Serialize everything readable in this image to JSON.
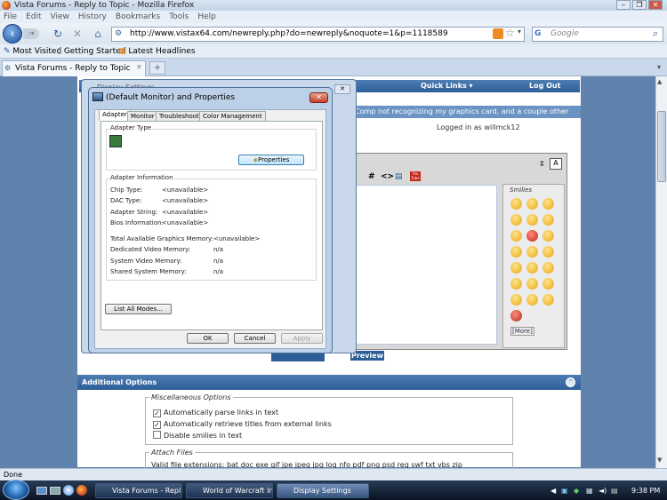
{
  "browser": {
    "title": "Vista Forums - Reply to Topic - Mozilla Firefox",
    "menu": [
      "File",
      "Edit",
      "View",
      "History",
      "Bookmarks",
      "Tools",
      "Help"
    ],
    "url": "http://www.vistax64.com/newreply.php?do=newreply&noquote=1&p=1118589",
    "search_placeholder": "Google",
    "bookmarks": [
      "Most Visited",
      "Getting Started",
      "Latest Headlines"
    ],
    "tab_label": "Vista Forums - Reply to Topic",
    "status": "Done"
  },
  "forum": {
    "quick_links": "Quick Links",
    "log_out": "Log Out",
    "subject_fragment": "Comp not recognizing my graphics card, and a couple other things",
    "logged_in": "Logged in as willmck12",
    "smilies_title": "Smilies",
    "more": "[More]",
    "preview_btn": "Preview Post",
    "additional_options": "Additional Options",
    "misc_legend": "Miscellaneous Options",
    "options": [
      {
        "label": "Automatically parse links in text",
        "checked": true
      },
      {
        "label": "Automatically retrieve titles from external links",
        "checked": true
      },
      {
        "label": "Disable smilies in text",
        "checked": false
      }
    ],
    "attach_legend": "Attach Files",
    "valid_ext": "Valid file extensions: bat doc exe gif jpe jpeg jpg log nfo pdf png psd reg swf txt vbs zip",
    "toolbar_glyphs": [
      "#",
      "<>",
      "▤",
      "You Tube"
    ]
  },
  "dialog": {
    "title": "(Default Monitor) and  Properties",
    "back_title": "Display Settings",
    "tabs": [
      "Adapter",
      "Monitor",
      "Troubleshoot",
      "Color Management"
    ],
    "adapter_type_label": "Adapter Type",
    "properties_btn": "Properties",
    "adapter_info_label": "Adapter Information",
    "info_rows": [
      {
        "k": "Chip Type:",
        "v": "<unavailable>"
      },
      {
        "k": "DAC Type:",
        "v": "<unavailable>"
      },
      {
        "k": "Adapter String:",
        "v": "<unavailable>"
      },
      {
        "k": "Bios Information:",
        "v": "<unavailable>"
      }
    ],
    "mem_rows": [
      {
        "k": "Total Available Graphics Memory:",
        "v": "<unavailable>"
      },
      {
        "k": "Dedicated Video Memory:",
        "v": "n/a"
      },
      {
        "k": "System Video Memory:",
        "v": "n/a"
      },
      {
        "k": "Shared System Memory:",
        "v": "n/a"
      }
    ],
    "list_modes_btn": "List All Modes...",
    "ok": "OK",
    "cancel": "Cancel",
    "apply": "Apply"
  },
  "taskbar": {
    "items": [
      "Vista Forums - Repl...",
      "World of Warcraft In...",
      "Display Settings"
    ],
    "clock": "9:38 PM"
  }
}
